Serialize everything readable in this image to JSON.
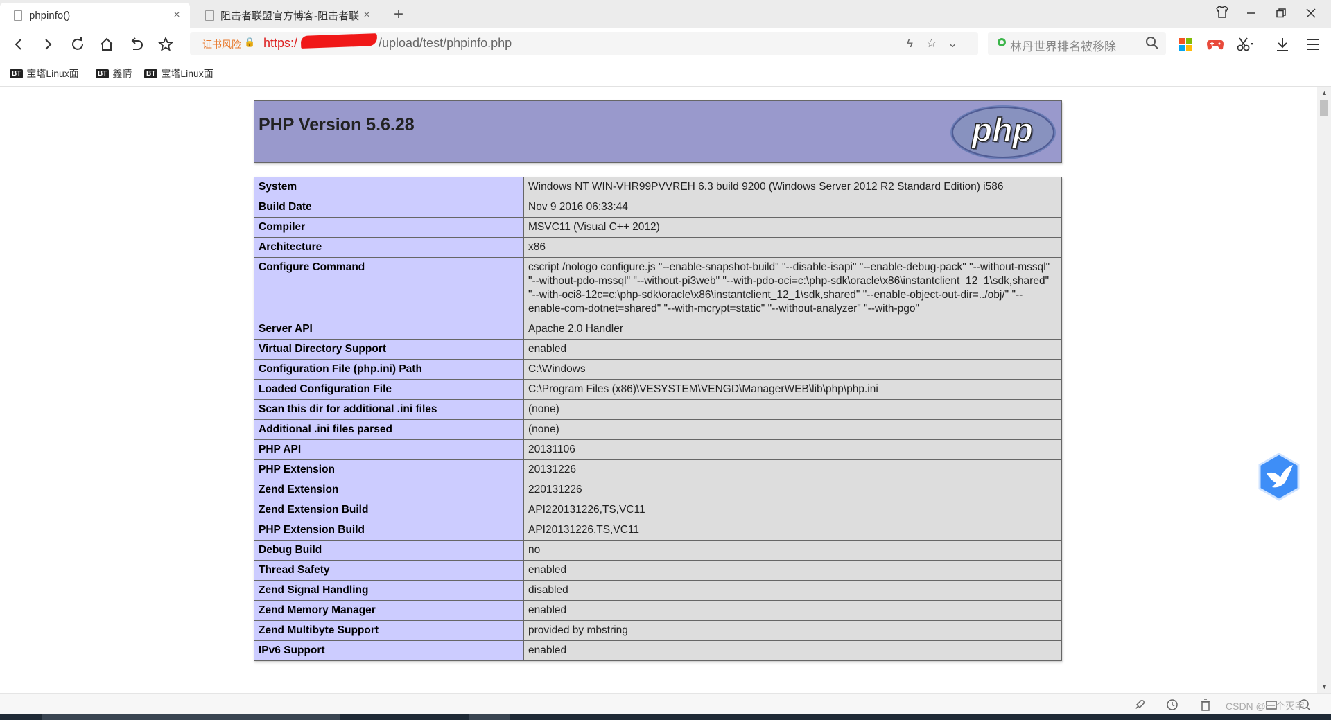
{
  "tabs": [
    {
      "label": "phpinfo()",
      "close": "×"
    },
    {
      "label": "阻击者联盟官方博客-阻击者联",
      "close": "×"
    }
  ],
  "newtab_label": "+",
  "address": {
    "warning": "证书风险",
    "protocol": "https:/",
    "path": "/upload/test/phpinfo.php"
  },
  "search": {
    "text": "林丹世界排名被移除"
  },
  "bookmarks": [
    {
      "badge": "BT",
      "label": "宝塔Linux面"
    },
    {
      "badge": "BT",
      "label": "鑫情"
    },
    {
      "badge": "BT",
      "label": "宝塔Linux面"
    }
  ],
  "php": {
    "title": "PHP Version 5.6.28",
    "logo_text": "php",
    "rows": [
      {
        "k": "System",
        "v": "Windows NT WIN-VHR99PVVREH 6.3 build 9200 (Windows Server 2012 R2 Standard Edition) i586"
      },
      {
        "k": "Build Date",
        "v": "Nov 9 2016 06:33:44"
      },
      {
        "k": "Compiler",
        "v": "MSVC11 (Visual C++ 2012)"
      },
      {
        "k": "Architecture",
        "v": "x86"
      },
      {
        "k": "Configure Command",
        "v": "cscript /nologo configure.js \"--enable-snapshot-build\" \"--disable-isapi\" \"--enable-debug-pack\" \"--without-mssql\" \"--without-pdo-mssql\" \"--without-pi3web\" \"--with-pdo-oci=c:\\php-sdk\\oracle\\x86\\instantclient_12_1\\sdk,shared\" \"--with-oci8-12c=c:\\php-sdk\\oracle\\x86\\instantclient_12_1\\sdk,shared\" \"--enable-object-out-dir=../obj/\" \"--enable-com-dotnet=shared\" \"--with-mcrypt=static\" \"--without-analyzer\" \"--with-pgo\""
      },
      {
        "k": "Server API",
        "v": "Apache 2.0 Handler"
      },
      {
        "k": "Virtual Directory Support",
        "v": "enabled"
      },
      {
        "k": "Configuration File (php.ini) Path",
        "v": "C:\\Windows"
      },
      {
        "k": "Loaded Configuration File",
        "v": "C:\\Program Files (x86)\\VESYSTEM\\VENGD\\ManagerWEB\\lib\\php\\php.ini"
      },
      {
        "k": "Scan this dir for additional .ini files",
        "v": "(none)"
      },
      {
        "k": "Additional .ini files parsed",
        "v": "(none)"
      },
      {
        "k": "PHP API",
        "v": "20131106"
      },
      {
        "k": "PHP Extension",
        "v": "20131226"
      },
      {
        "k": "Zend Extension",
        "v": "220131226"
      },
      {
        "k": "Zend Extension Build",
        "v": "API220131226,TS,VC11"
      },
      {
        "k": "PHP Extension Build",
        "v": "API20131226,TS,VC11"
      },
      {
        "k": "Debug Build",
        "v": "no"
      },
      {
        "k": "Thread Safety",
        "v": "enabled"
      },
      {
        "k": "Zend Signal Handling",
        "v": "disabled"
      },
      {
        "k": "Zend Memory Manager",
        "v": "enabled"
      },
      {
        "k": "Zend Multibyte Support",
        "v": "provided by mbstring"
      },
      {
        "k": "IPv6 Support",
        "v": "enabled"
      }
    ]
  },
  "watermark": "CSDN @一个灭字",
  "colors": {
    "php_header": "#9999cc",
    "key_cell": "#ccccff",
    "value_cell": "#dddddd",
    "warning": "#e8782a",
    "protocol": "#dd2222"
  }
}
